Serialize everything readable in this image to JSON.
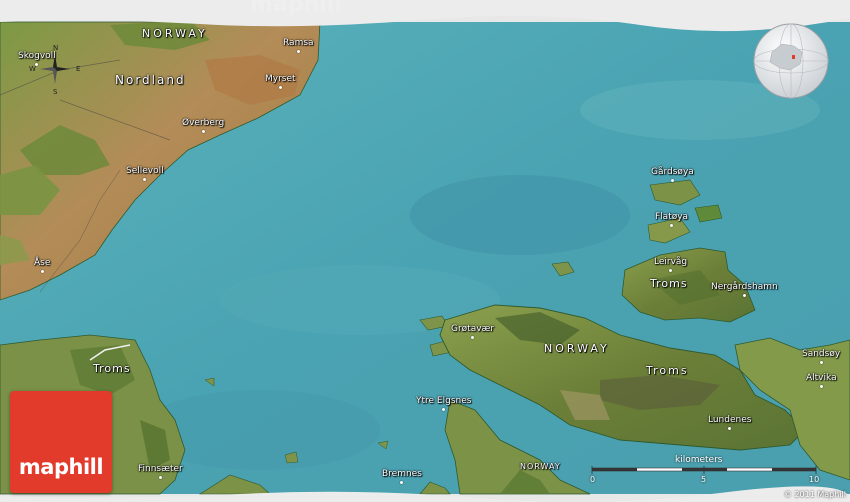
{
  "map": {
    "watermark": "maphill",
    "logo": "maphill",
    "copyright": "© 2011 Maphill",
    "scale": {
      "title": "kilometers",
      "ticks": [
        "0",
        "5",
        "10"
      ]
    },
    "compass": {
      "n": "N",
      "s": "S",
      "e": "E",
      "w": "W"
    },
    "labels": {
      "norway_top": "NORWAY",
      "nordland": "Nordland",
      "skogvoll": "Skogvoll",
      "ramsa": "Ramsa",
      "myrset": "Myrset",
      "overberg": "Øverberg",
      "sellevoll": "Sellevoll",
      "ase": "Åse",
      "gardsoya": "Gårdsøya",
      "flatoya": "Flatøya",
      "leirvag": "Leirvåg",
      "troms_east": "Troms",
      "nergardshamn": "Nergårdshamn",
      "grotavar": "Grøtavær",
      "norway_mid": "NORWAY",
      "troms_mid": "Troms",
      "sandsoy": "Sandsøy",
      "altvika": "Altvika",
      "lundenes": "Lundenes",
      "ytre_elgsnes": "Ytre Elgsnes",
      "troms_west": "Troms",
      "finnsater": "Finnsæter",
      "bremnes": "Bremnes",
      "norway_bottom": "NORWAY"
    },
    "colors": {
      "sea": "#4fa8b4",
      "deep_sea": "#3f93a6",
      "land_green": "#6f8c3a",
      "land_brown": "#b28a55",
      "brand_red": "#e23a2b"
    }
  }
}
